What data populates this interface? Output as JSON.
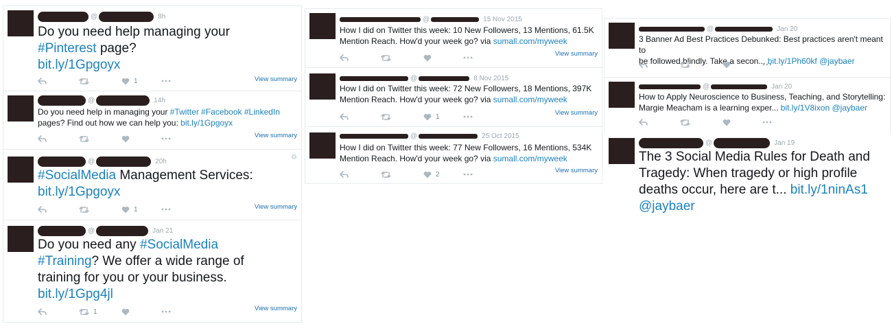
{
  "view_summary": "View summary",
  "columns": [
    {
      "tweets": [
        {
          "time": "8h",
          "text_parts": [
            {
              "t": "Do you need help managing your\n",
              "link": false
            },
            {
              "t": "#Pinterest",
              "link": true
            },
            {
              "t": " page?\n",
              "link": false
            },
            {
              "t": "bit.ly/1Gpgoyx",
              "link": true
            }
          ],
          "likes": "1"
        },
        {
          "time": "14h",
          "text_parts": [
            {
              "t": "Do you need help in managing your ",
              "link": false
            },
            {
              "t": "#Twitter",
              "link": true
            },
            {
              "t": " ",
              "link": false
            },
            {
              "t": "#Facebook",
              "link": true
            },
            {
              "t": " ",
              "link": false
            },
            {
              "t": "#LinkedIn",
              "link": true
            },
            {
              "t": "\npages? Find out how we can help you: ",
              "link": false
            },
            {
              "t": "bit.ly/1Gpgoyx",
              "link": true
            }
          ],
          "likes": ""
        },
        {
          "time": "20h",
          "text_parts": [
            {
              "t": "#SocialMedia",
              "link": true
            },
            {
              "t": " Management Services:\n",
              "link": false
            },
            {
              "t": "bit.ly/1Gpgoyx",
              "link": true
            }
          ],
          "likes": "1"
        },
        {
          "time": "Jan 21",
          "text_parts": [
            {
              "t": "Do you need any ",
              "link": false
            },
            {
              "t": "#SocialMedia",
              "link": true
            },
            {
              "t": "\n",
              "link": false
            },
            {
              "t": "#Training",
              "link": true
            },
            {
              "t": "? We offer a wide range of\ntraining for you or your business.\n",
              "link": false
            },
            {
              "t": "bit.ly/1Gpg4jl",
              "link": true
            }
          ],
          "retweets": "1",
          "likes": ""
        }
      ]
    },
    {
      "tweets": [
        {
          "time": "15 Nov 2015",
          "text_parts": [
            {
              "t": "How I did on Twitter this week: 10 New Followers, 13 Mentions, 61.5K\nMention Reach. How'd your week go? via ",
              "link": false
            },
            {
              "t": "sumall.com/myweek",
              "link": true
            }
          ],
          "likes": ""
        },
        {
          "time": "8 Nov 2015",
          "text_parts": [
            {
              "t": "How I did on Twitter this week: 72 New Followers, 18 Mentions, 397K\nMention Reach. How'd your week go? via ",
              "link": false
            },
            {
              "t": "sumall.com/myweek",
              "link": true
            }
          ],
          "likes": "1"
        },
        {
          "time": "25 Oct 2015",
          "text_parts": [
            {
              "t": "How I did on Twitter this week: 77 New Followers, 16 Mentions, 534K\nMention Reach. How'd your week go? via ",
              "link": false
            },
            {
              "t": "sumall.com/myweek",
              "link": true
            }
          ],
          "likes": "2"
        }
      ]
    },
    {
      "tweets": [
        {
          "time": "Jan 20",
          "text_parts": [
            {
              "t": "3 Banner Ad Best Practices Debunked: Best practices aren't meant to\nbe followed blindly. Take a secon... ",
              "link": false
            },
            {
              "t": "bit.ly/1Ph60kf",
              "link": true
            },
            {
              "t": " ",
              "link": false
            },
            {
              "t": "@jaybaer",
              "link": true
            }
          ]
        },
        {
          "time": "Jan 20",
          "text_parts": [
            {
              "t": "How to Apply Neuroscience to Business, Teaching, and Storytelling:\nMargie Meacham is a learning exper... ",
              "link": false
            },
            {
              "t": "bit.ly/1V8ixon",
              "link": true
            },
            {
              "t": " ",
              "link": false
            },
            {
              "t": "@jaybaer",
              "link": true
            }
          ]
        },
        {
          "time": "Jan 19",
          "text_parts": [
            {
              "t": "The 3 Social Media Rules for Death and\nTragedy: When tragedy or high profile\ndeaths occur, here are t... ",
              "link": false
            },
            {
              "t": "bit.ly/1ninAs1",
              "link": true
            },
            {
              "t": "\n",
              "link": false
            },
            {
              "t": "@jaybaer",
              "link": true
            }
          ]
        }
      ]
    }
  ]
}
